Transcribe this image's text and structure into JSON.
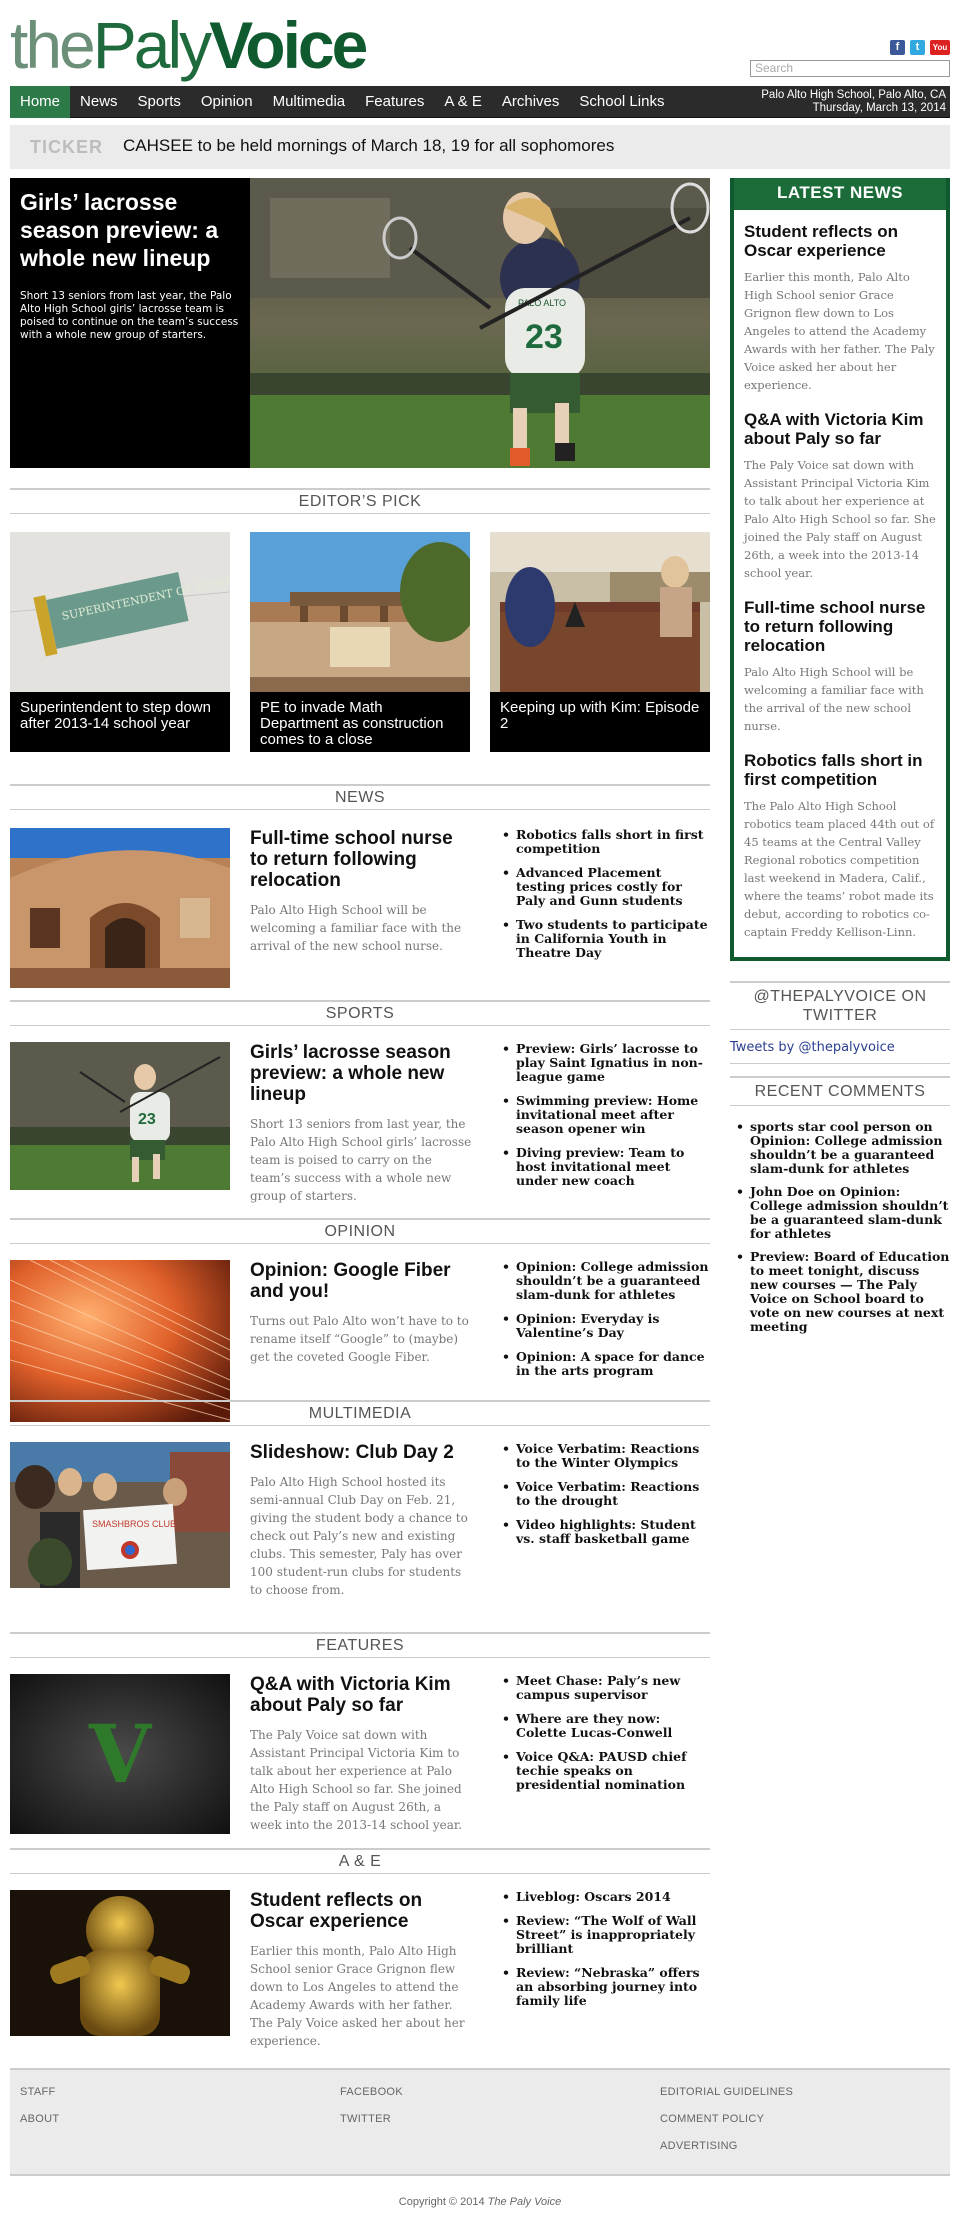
{
  "site": {
    "logo_the": "the",
    "logo_paly": "Paly",
    "logo_voice": "Voice"
  },
  "search": {
    "placeholder": "Search"
  },
  "social": {
    "facebook": "f",
    "twitter": "t",
    "youtube": "You"
  },
  "nav": {
    "items": [
      "Home",
      "News",
      "Sports",
      "Opinion",
      "Multimedia",
      "Features",
      "A & E",
      "Archives",
      "School Links"
    ],
    "location": "Palo Alto High School, Palo Alto, CA",
    "date": "Thursday, March 13, 2014"
  },
  "ticker": {
    "label": "TICKER",
    "text": "CAHSEE to be held mornings of March 18, 19 for all sophomores"
  },
  "hero": {
    "title": "Girls’ lacrosse season preview: a whole new lineup",
    "excerpt": "Short 13 seniors from last year, the Palo Alto High School girls’ lacrosse team is poised to continue on the team’s success with a whole new group of starters."
  },
  "editors_pick": {
    "heading": "EDITOR’S PICK",
    "items": [
      {
        "caption": "Superintendent to step down after 2013-14 school year",
        "sign_text": "SUPERINTENDENT OF SCHOOLS"
      },
      {
        "caption": "PE to invade Math Department as construction comes to a close"
      },
      {
        "caption": "Keeping up with Kim: Episode 2"
      }
    ]
  },
  "sections": [
    {
      "heading": "NEWS",
      "title": "Full-time school nurse to return following relocation",
      "excerpt": "Palo Alto High School will be welcoming a familiar face with the arrival of the new school nurse.",
      "links": [
        "Robotics falls short in first competition",
        "Advanced Placement testing prices costly for Paly and Gunn students",
        "Two students to participate in California Youth in Theatre Day"
      ]
    },
    {
      "heading": "SPORTS",
      "title": "Girls’ lacrosse season preview: a whole new lineup",
      "excerpt": "Short 13 seniors from last year, the Palo Alto High School girls’ lacrosse team is poised to carry on the team’s success with a whole new group of starters.",
      "links": [
        "Preview: Girls’ lacrosse to play Saint Ignatius in non-league game",
        "Swimming preview: Home invitational meet after season opener win",
        "Diving preview: Team to host invitational meet under new coach"
      ]
    },
    {
      "heading": "OPINION",
      "title": "Opinion: Google Fiber and you!",
      "excerpt": "Turns out Palo Alto won’t have to to rename itself “Google” to (maybe) get the coveted Google Fiber.",
      "links": [
        "Opinion: College admission shouldn’t be a guaranteed slam-dunk for athletes",
        "Opinion: Everyday is Valentine’s Day",
        "Opinion: A space for dance in the arts program"
      ]
    },
    {
      "heading": "MULTIMEDIA",
      "title": "Slideshow: Club Day 2",
      "excerpt": "Palo Alto High School hosted its semi-annual Club Day on Feb. 21, giving the student body a chance to check out Paly’s new and existing clubs. This semester, Paly has over 100 student-run clubs for students to choose from.",
      "links": [
        "Voice Verbatim: Reactions to the Winter Olympics",
        "Voice Verbatim: Reactions to the drought",
        "Video highlights: Student vs. staff basketball game"
      ],
      "sign_text": "SMASHBROS CLUB"
    },
    {
      "heading": "FEATURES",
      "title": "Q&A with Victoria Kim about Paly so far",
      "excerpt": "The Paly Voice sat down with Assistant Principal Victoria Kim to talk about her experience at Palo Alto High School so far. She joined the Paly staff on August 26th, a week into the 2013-14 school year.",
      "links": [
        "Meet Chase: Paly’s new campus supervisor",
        "Where are they now: Colette Lucas-Conwell",
        "Voice Q&A: PAUSD chief techie speaks on presidential nomination"
      ],
      "image_letter": "V"
    },
    {
      "heading": "A & E",
      "title": "Student reflects on Oscar experience",
      "excerpt": "Earlier this month, Palo Alto High School senior Grace Grignon flew down to Los Angeles to attend the Academy Awards with her father. The Paly Voice asked her about her experience.",
      "links": [
        "Liveblog: Oscars 2014",
        "Review: “The Wolf of Wall Street” is inappropriately brilliant",
        "Review: “Nebraska” offers an absorbing journey into family life"
      ]
    }
  ],
  "latest_news": {
    "heading": "LATEST NEWS",
    "items": [
      {
        "title": "Student reflects on Oscar experience",
        "excerpt": "Earlier this month, Palo Alto High School senior Grace Grignon flew down to Los Angeles to attend the Academy Awards with her father. The Paly Voice asked her about her experience."
      },
      {
        "title": "Q&A with Victoria Kim about Paly so far",
        "excerpt": "The Paly Voice sat down with Assistant Principal Victoria Kim to talk about her experience at Palo Alto High School so far. She joined the Paly staff on August 26th, a week into the 2013-14 school year."
      },
      {
        "title": "Full-time school nurse to return following relocation",
        "excerpt": "Palo Alto High School will be welcoming a familiar face with the arrival of the new school nurse."
      },
      {
        "title": "Robotics falls short in first competition",
        "excerpt": "The Palo Alto High School robotics team placed 44th out of 45 teams at the Central Valley Regional robotics competition last weekend in Madera, Calif., where the teams’ robot made its debut, according to robotics co-captain Freddy Kellison-Linn."
      }
    ]
  },
  "twitter": {
    "heading": "@THEPALYVOICE ON TWITTER",
    "link": "Tweets by @thepalyvoice"
  },
  "recent_comments": {
    "heading": "RECENT COMMENTS",
    "items": [
      "sports star cool person on Opinion: College admission shouldn’t be a guaranteed slam-dunk for athletes",
      "John Doe on Opinion: College admission shouldn’t be a guaranteed slam-dunk for athletes",
      "Preview: Board of Education to meet tonight, discuss new courses — The Paly Voice on School board to vote on new courses at next meeting"
    ]
  },
  "hero_jersey": "23",
  "hero_jersey_text": "PALO ALTO",
  "footer": {
    "col1": [
      "STAFF",
      "ABOUT"
    ],
    "col2": [
      "FACEBOOK",
      "TWITTER"
    ],
    "col3": [
      "EDITORIAL GUIDELINES",
      "COMMENT POLICY",
      "ADVERTISING"
    ],
    "copyright_prefix": "Copyright © 2014 ",
    "copyright_name": "The Paly Voice"
  }
}
